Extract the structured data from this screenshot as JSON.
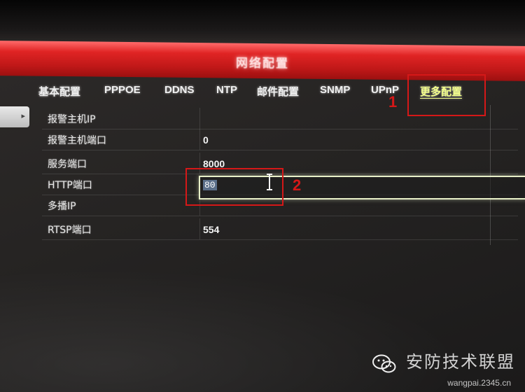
{
  "window": {
    "title": "网络配置"
  },
  "tabs": [
    {
      "label": "基本配置"
    },
    {
      "label": "PPPOE"
    },
    {
      "label": "DDNS"
    },
    {
      "label": "NTP"
    },
    {
      "label": "邮件配置"
    },
    {
      "label": "SNMP"
    },
    {
      "label": "UPnP"
    },
    {
      "label": "更多配置"
    }
  ],
  "active_tab": "更多配置",
  "fields": [
    {
      "label": "报警主机IP",
      "value": ""
    },
    {
      "label": "报警主机端口",
      "value": "0"
    },
    {
      "label": "服务端口",
      "value": "8000"
    },
    {
      "label": "HTTP端口",
      "value": "80"
    },
    {
      "label": "多播IP",
      "value": ""
    },
    {
      "label": "RTSP端口",
      "value": "554"
    }
  ],
  "annotations": {
    "marker_1": "1",
    "marker_2": "2",
    "color": "#d51818"
  },
  "watermark": {
    "main": "安防技术联盟",
    "sub": "wangpai.2345.cn"
  },
  "colors": {
    "titlebar": "#d42020",
    "active_tab": "#f4ff8a",
    "input_border": "#e8f0c8"
  }
}
